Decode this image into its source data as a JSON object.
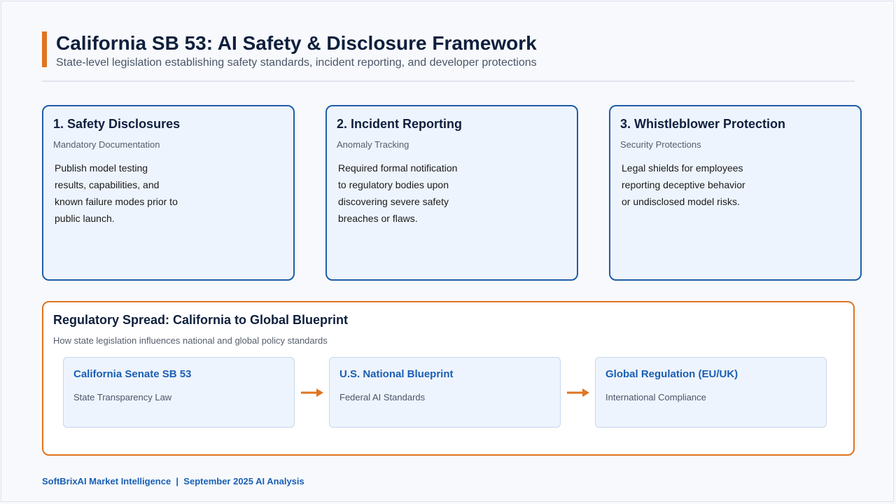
{
  "header": {
    "title": "California SB 53: AI Safety & Disclosure Framework",
    "subtitle": "State-level legislation establishing safety standards, incident reporting, and developer protections"
  },
  "cards": [
    {
      "title": "1. Safety Disclosures",
      "subtitle": "Mandatory Documentation",
      "lines": [
        "Publish model testing",
        "results, capabilities, and",
        "known failure modes prior to",
        "public launch."
      ]
    },
    {
      "title": "2. Incident Reporting",
      "subtitle": "Anomaly Tracking",
      "lines": [
        "Required formal notification",
        "to regulatory bodies upon",
        "discovering severe safety",
        "breaches or flaws."
      ]
    },
    {
      "title": "3. Whistleblower Protection",
      "subtitle": "Security Protections",
      "lines": [
        "Legal shields for employees",
        "reporting deceptive behavior",
        "or undisclosed model risks."
      ]
    }
  ],
  "spread": {
    "title": "Regulatory Spread: California to Global Blueprint",
    "subtitle": "How state legislation influences national and global policy standards",
    "stages": [
      {
        "title": "California Senate SB 53",
        "subtitle": "State Transparency Law"
      },
      {
        "title": "U.S. National Blueprint",
        "subtitle": "Federal AI Standards"
      },
      {
        "title": "Global Regulation (EU/UK)",
        "subtitle": "International Compliance"
      }
    ]
  },
  "footer": {
    "text": "SoftBrixAI Market Intelligence  |  September 2025 AI Analysis"
  },
  "colors": {
    "accent": "#e07420",
    "primary": "#1e5ea8",
    "stage_title": "#1a5fb4",
    "heading": "#0f1f3d"
  }
}
